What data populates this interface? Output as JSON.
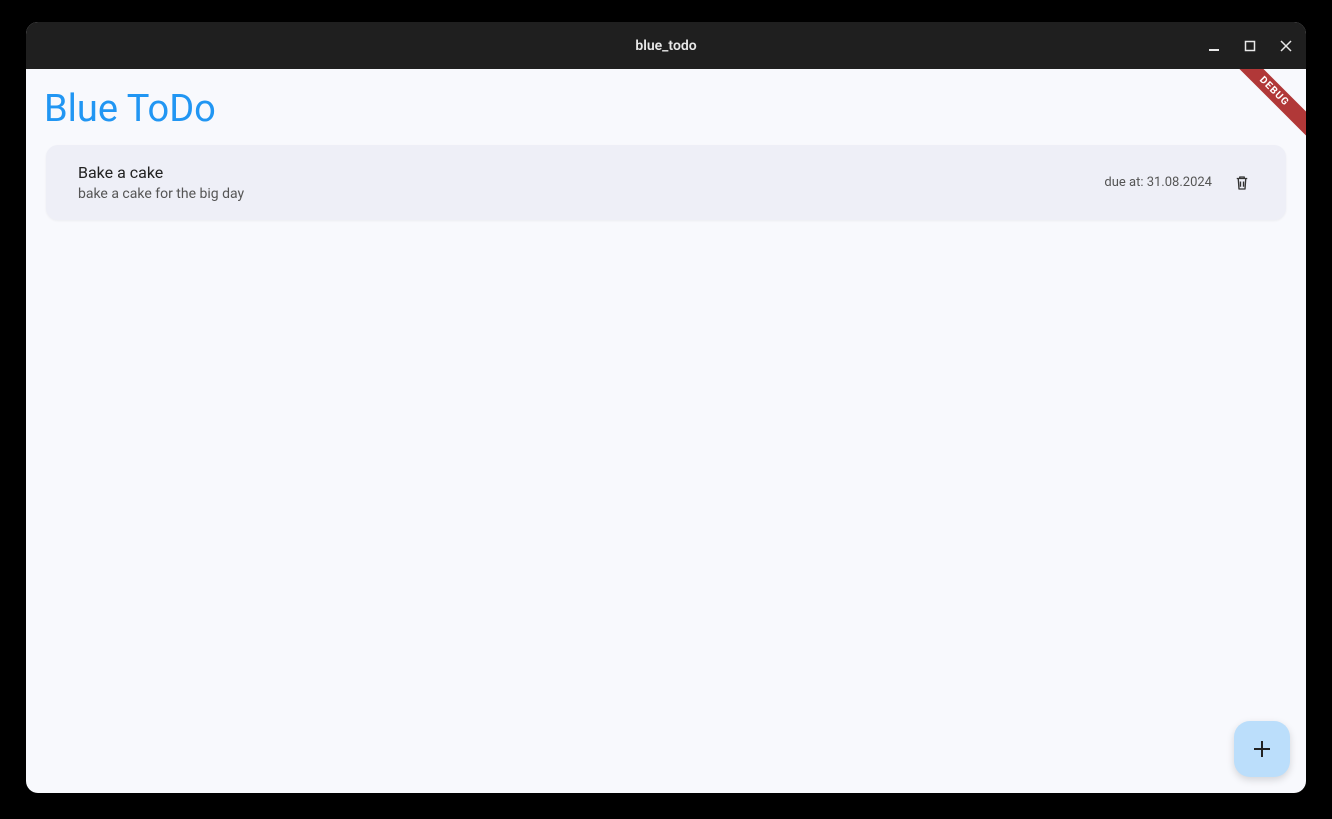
{
  "window": {
    "title": "blue_todo"
  },
  "debug_banner": "DEBUG",
  "app": {
    "title": "Blue ToDo"
  },
  "todos": [
    {
      "title": "Bake a cake",
      "description": "bake a cake for the big day",
      "due_label": "due at: 31.08.2024"
    }
  ]
}
